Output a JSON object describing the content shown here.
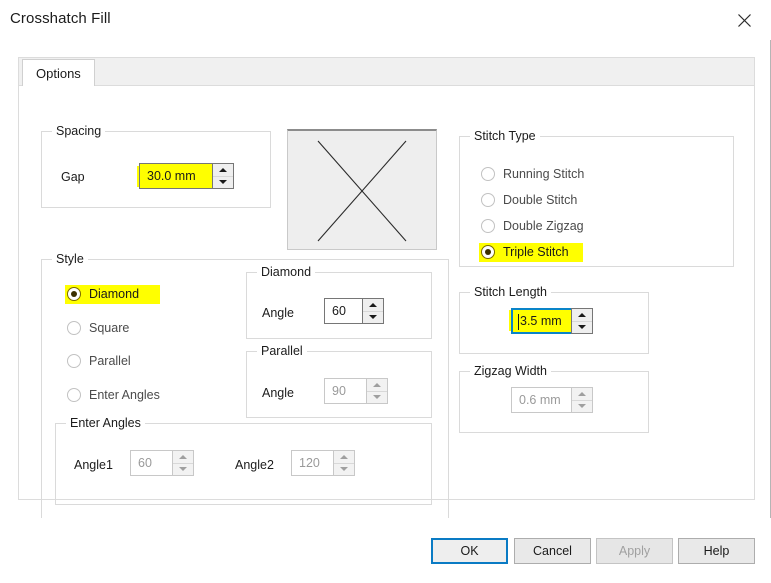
{
  "window": {
    "title": "Crosshatch Fill",
    "close_icon": "close-icon"
  },
  "tabs": [
    {
      "label": "Options",
      "selected": true
    }
  ],
  "spacing": {
    "group_label": "Spacing",
    "gap_label": "Gap",
    "gap_value": "30.0 mm",
    "gap_highlighted": true
  },
  "preview": {
    "name": "crosshatch-preview",
    "description": "X shaped crosshatch pattern preview"
  },
  "style": {
    "group_label": "Style",
    "options": [
      {
        "label": "Diamond",
        "selected": true,
        "highlighted": true
      },
      {
        "label": "Square",
        "selected": false,
        "highlighted": false
      },
      {
        "label": "Parallel",
        "selected": false,
        "highlighted": false
      },
      {
        "label": "Enter Angles",
        "selected": false,
        "highlighted": false
      }
    ]
  },
  "diamond": {
    "group_label": "Diamond",
    "angle_label": "Angle",
    "angle_value": "60",
    "enabled": true
  },
  "parallel": {
    "group_label": "Parallel",
    "angle_label": "Angle",
    "angle_value": "90",
    "enabled": false
  },
  "enter_angles": {
    "group_label": "Enter Angles",
    "angle1_label": "Angle1",
    "angle1_value": "60",
    "angle2_label": "Angle2",
    "angle2_value": "120",
    "enabled": false
  },
  "stitch_type": {
    "group_label": "Stitch Type",
    "options": [
      {
        "label": "Running Stitch",
        "selected": false,
        "highlighted": false
      },
      {
        "label": "Double Stitch",
        "selected": false,
        "highlighted": false
      },
      {
        "label": "Double Zigzag",
        "selected": false,
        "highlighted": false
      },
      {
        "label": "Triple Stitch",
        "selected": true,
        "highlighted": true
      }
    ]
  },
  "stitch_length": {
    "group_label": "Stitch Length",
    "value": "3.5 mm",
    "highlighted": true,
    "focused": true
  },
  "zigzag_width": {
    "group_label": "Zigzag Width",
    "value": "0.6 mm",
    "enabled": false
  },
  "footer": {
    "ok_label": "OK",
    "cancel_label": "Cancel",
    "apply_label": "Apply",
    "help_label": "Help",
    "apply_enabled": false,
    "ok_is_default": true
  },
  "colors": {
    "highlight_yellow": "#ffff00",
    "focus_blue": "#0a84c8",
    "default_button_blue": "#0a7bc4",
    "group_border": "#dadada",
    "text": "#1a1a1a",
    "disabled_text": "#9a9a9a"
  }
}
